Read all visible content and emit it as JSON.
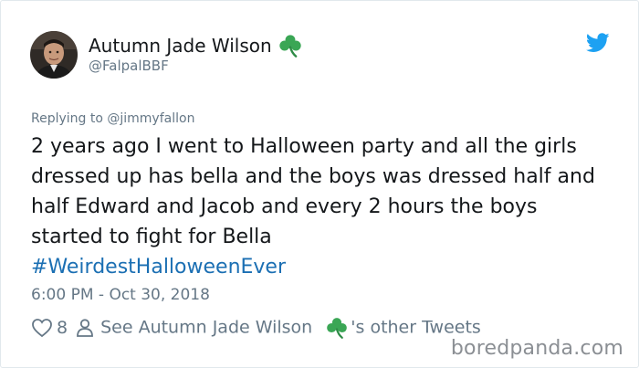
{
  "tweet": {
    "author_name": "Autumn Jade Wilson",
    "author_handle": "@FalpalBBF",
    "reply_to": "Replying to @jimmyfallon",
    "body": "2 years ago I went to Halloween party and all the girls dressed up has bella and the boys was dressed half and half Edward and Jacob and every 2 hours the boys started to fight for Bella",
    "hashtag": "#WeirdestHalloweenEver",
    "timestamp": "6:00 PM - Oct 30, 2018",
    "like_count": "8",
    "other_tweets_prefix": "See Autumn Jade Wilson",
    "other_tweets_suffix": "'s other Tweets"
  },
  "watermark": "boredpanda.com",
  "icons": {
    "clover": "shamrock-icon",
    "bird": "twitter-bird-icon",
    "like": "heart-icon",
    "profile": "person-icon"
  },
  "colors": {
    "link": "#1b6fb3",
    "muted": "#657786",
    "twitter_blue": "#1da1f2",
    "clover_green": "#3aa655"
  }
}
